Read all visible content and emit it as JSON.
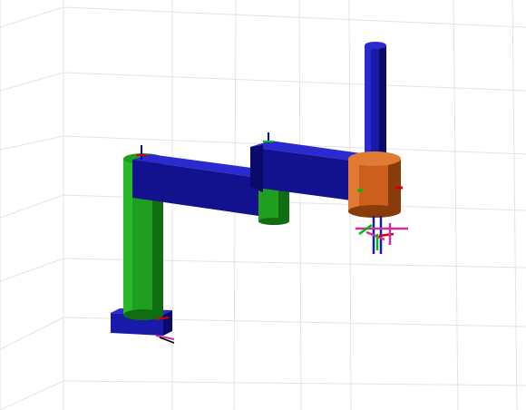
{
  "viewport": {
    "background": "#ffffff",
    "grid_color": "#e3e3e3"
  },
  "robot": {
    "type": "SCARA manipulator (3D render)",
    "colors": {
      "base": "#1a1aa8",
      "column": "#1f9e1f",
      "column_shade": "#106e10",
      "arm": "#12128f",
      "arm_top": "#2a2ad0",
      "arm_side": "#0a0a6a",
      "joint_housing": "#cc5f1c",
      "joint_housing_dark": "#8a3b0a",
      "z_shaft": "#1a1aa8"
    },
    "frame_axes": {
      "x_color": "#d40000",
      "y_color": "#00c000",
      "z_color": "#0000e0",
      "tool_color": "#cc2fa6"
    }
  }
}
